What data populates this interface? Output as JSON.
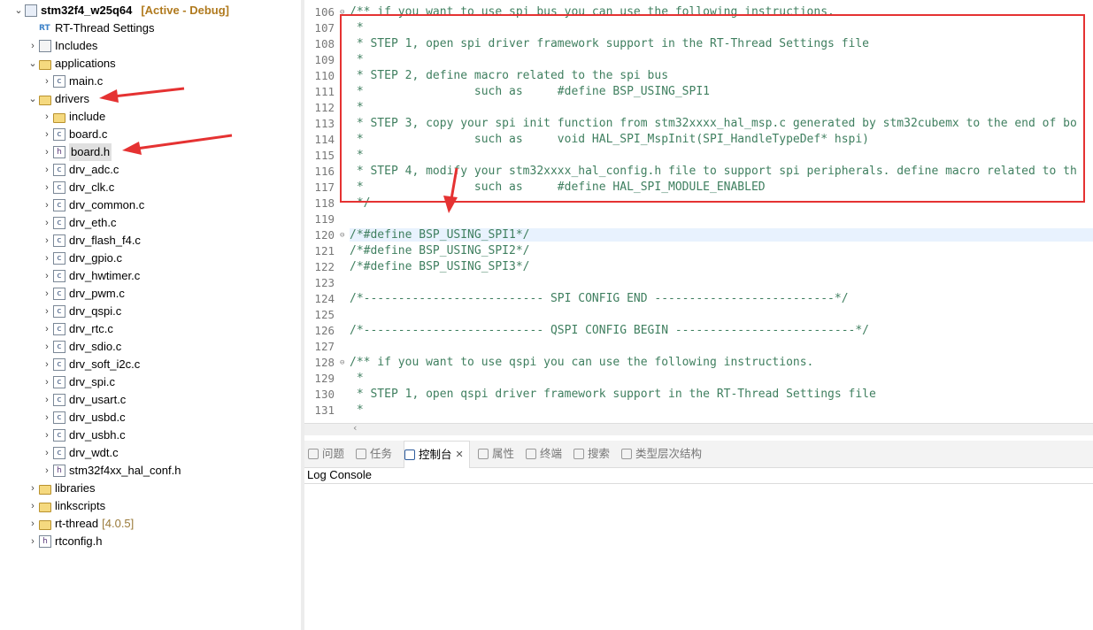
{
  "tree": {
    "project": {
      "name": "stm32f4_w25q64",
      "status": "[Active - Debug]"
    },
    "items": [
      {
        "label": "RT-Thread Settings",
        "icon": "rt-thread-settings-icon"
      },
      {
        "label": "Includes",
        "icon": "includes-icon"
      },
      {
        "label": "applications",
        "icon": "folder-icon"
      },
      {
        "label": "main.c",
        "icon": "c-file-icon"
      },
      {
        "label": "drivers",
        "icon": "folder-icon"
      },
      {
        "label": "include",
        "icon": "folder-icon"
      },
      {
        "label": "board.c",
        "icon": "c-file-icon"
      },
      {
        "label": "board.h",
        "icon": "h-file-icon"
      },
      {
        "label": "drv_adc.c",
        "icon": "c-file-icon"
      },
      {
        "label": "drv_clk.c",
        "icon": "c-file-icon"
      },
      {
        "label": "drv_common.c",
        "icon": "c-file-icon"
      },
      {
        "label": "drv_eth.c",
        "icon": "c-file-icon"
      },
      {
        "label": "drv_flash_f4.c",
        "icon": "c-file-icon"
      },
      {
        "label": "drv_gpio.c",
        "icon": "c-file-icon"
      },
      {
        "label": "drv_hwtimer.c",
        "icon": "c-file-icon"
      },
      {
        "label": "drv_pwm.c",
        "icon": "c-file-icon"
      },
      {
        "label": "drv_qspi.c",
        "icon": "c-file-icon"
      },
      {
        "label": "drv_rtc.c",
        "icon": "c-file-icon"
      },
      {
        "label": "drv_sdio.c",
        "icon": "c-file-icon"
      },
      {
        "label": "drv_soft_i2c.c",
        "icon": "c-file-icon"
      },
      {
        "label": "drv_spi.c",
        "icon": "c-file-icon"
      },
      {
        "label": "drv_usart.c",
        "icon": "c-file-icon"
      },
      {
        "label": "drv_usbd.c",
        "icon": "c-file-icon"
      },
      {
        "label": "drv_usbh.c",
        "icon": "c-file-icon"
      },
      {
        "label": "drv_wdt.c",
        "icon": "c-file-icon"
      },
      {
        "label": "stm32f4xx_hal_conf.h",
        "icon": "h-file-icon"
      },
      {
        "label": "libraries",
        "icon": "folder-icon"
      },
      {
        "label": "linkscripts",
        "icon": "folder-icon"
      },
      {
        "label": "rt-thread",
        "icon": "folder-icon",
        "decoration": "[4.0.5]"
      },
      {
        "label": "rtconfig.h",
        "icon": "h-file-icon"
      }
    ]
  },
  "editor": {
    "lines": [
      {
        "num": "106",
        "text": "/** if you want to use spi bus you can use the following instructions."
      },
      {
        "num": "107",
        "text": " *"
      },
      {
        "num": "108",
        "text": " * STEP 1, open spi driver framework support in the RT-Thread Settings file"
      },
      {
        "num": "109",
        "text": " *"
      },
      {
        "num": "110",
        "text": " * STEP 2, define macro related to the spi bus"
      },
      {
        "num": "111",
        "text": " *                such as     #define BSP_USING_SPI1"
      },
      {
        "num": "112",
        "text": " *"
      },
      {
        "num": "113",
        "text": " * STEP 3, copy your spi init function from stm32xxxx_hal_msp.c generated by stm32cubemx to the end of bo"
      },
      {
        "num": "114",
        "text": " *                such as     void HAL_SPI_MspInit(SPI_HandleTypeDef* hspi)"
      },
      {
        "num": "115",
        "text": " *"
      },
      {
        "num": "116",
        "text": " * STEP 4, modify your stm32xxxx_hal_config.h file to support spi peripherals. define macro related to th"
      },
      {
        "num": "117",
        "text": " *                such as     #define HAL_SPI_MODULE_ENABLED"
      },
      {
        "num": "118",
        "text": " */"
      },
      {
        "num": "119",
        "text": ""
      },
      {
        "num": "120",
        "text": "/*#define BSP_USING_SPI1*/"
      },
      {
        "num": "121",
        "text": "/*#define BSP_USING_SPI2*/"
      },
      {
        "num": "122",
        "text": "/*#define BSP_USING_SPI3*/"
      },
      {
        "num": "123",
        "text": ""
      },
      {
        "num": "124",
        "text": "/*-------------------------- SPI CONFIG END --------------------------*/"
      },
      {
        "num": "125",
        "text": ""
      },
      {
        "num": "126",
        "text": "/*-------------------------- QSPI CONFIG BEGIN --------------------------*/"
      },
      {
        "num": "127",
        "text": ""
      },
      {
        "num": "128",
        "text": "/** if you want to use qspi you can use the following instructions."
      },
      {
        "num": "129",
        "text": " *"
      },
      {
        "num": "130",
        "text": " * STEP 1, open qspi driver framework support in the RT-Thread Settings file"
      },
      {
        "num": "131",
        "text": " *"
      }
    ]
  },
  "panel": {
    "tabs": [
      {
        "label": "问题",
        "icon": "problems-icon"
      },
      {
        "label": "任务",
        "icon": "tasks-icon"
      },
      {
        "label": "控制台",
        "icon": "console-icon",
        "active": true
      },
      {
        "label": "属性",
        "icon": "properties-icon"
      },
      {
        "label": "终端",
        "icon": "terminal-icon"
      },
      {
        "label": "搜索",
        "icon": "search-icon"
      },
      {
        "label": "类型层次结构",
        "icon": "type-hierarchy-icon"
      }
    ],
    "console_title": "Log Console"
  },
  "colors": {
    "comment": "#3f7f5f",
    "annotation_red": "#e53232",
    "line_number": "#787878"
  }
}
